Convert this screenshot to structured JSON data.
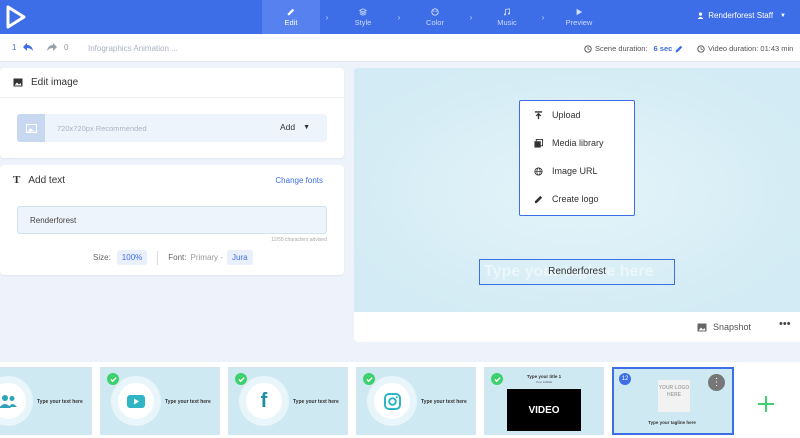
{
  "colors": {
    "primary": "#3d6ee8",
    "success": "#3ecf6e",
    "preview_bg": "#d9eef6"
  },
  "nav": {
    "steps": [
      {
        "label": "Edit",
        "icon": "pencil-icon",
        "active": true
      },
      {
        "label": "Style",
        "icon": "layers-icon",
        "active": false
      },
      {
        "label": "Color",
        "icon": "palette-icon",
        "active": false
      },
      {
        "label": "Music",
        "icon": "music-note-icon",
        "active": false
      },
      {
        "label": "Preview",
        "icon": "play-icon",
        "active": false
      }
    ],
    "user": "Renderforest Staff"
  },
  "toolbar": {
    "undo_count": "1",
    "redo_count": "0",
    "project_title": "Infographics Animation ...",
    "scene_duration_label": "Scene duration:",
    "scene_duration_value": "6 sec",
    "video_duration": "Video duration: 01:43 min"
  },
  "edit_image": {
    "title": "Edit image",
    "hint": "720x720px Recommended",
    "add_label": "Add"
  },
  "add_text": {
    "title": "Add text",
    "change_fonts": "Change fonts",
    "value": "Renderforest",
    "char_advice": "12/55 characters advised",
    "size_label": "Size:",
    "size_value": "100%",
    "font_label": "Font:",
    "font_primary": "Primary -",
    "font_value": "Jura"
  },
  "preview": {
    "menu": [
      {
        "label": "Upload",
        "icon": "upload-icon"
      },
      {
        "label": "Media library",
        "icon": "media-library-icon"
      },
      {
        "label": "Image URL",
        "icon": "globe-icon"
      },
      {
        "label": "Create logo",
        "icon": "pencil-icon"
      }
    ],
    "ghost_text": "Type your tagline here",
    "tagline": "Renderforest",
    "snapshot": "Snapshot"
  },
  "timeline": {
    "scenes": [
      {
        "caption": "Type your text here",
        "icon": "users-icon"
      },
      {
        "caption": "Type your text here",
        "icon": "youtube-icon"
      },
      {
        "caption": "Type your text here",
        "icon": "facebook-icon"
      },
      {
        "caption": "Type your text here",
        "icon": "instagram-icon"
      },
      {
        "title": "Type your title 1",
        "subtitle": "Your subtitle",
        "video_label": "VIDEO"
      },
      {
        "number": "12",
        "logo_text": "YOUR LOGO HERE",
        "tagline": "Type your tagline here"
      }
    ]
  }
}
